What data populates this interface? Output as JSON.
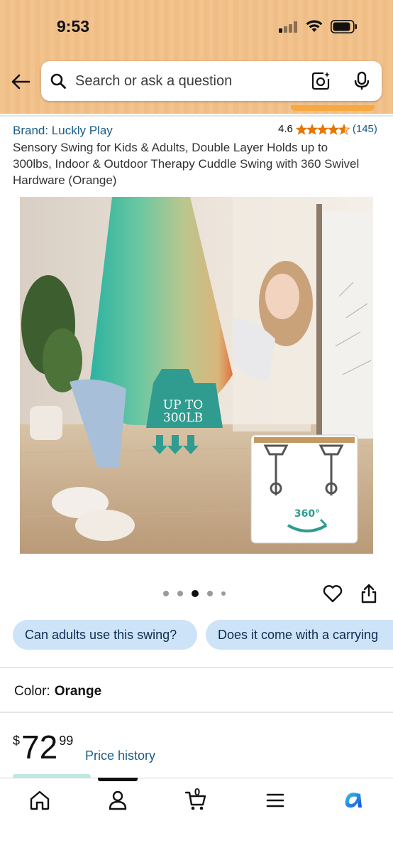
{
  "status_bar": {
    "time": "9:53"
  },
  "search": {
    "placeholder": "Search or ask a question"
  },
  "product": {
    "brand": "Brand: Luckly Play",
    "rating_value": "4.6",
    "rating_stars": 4.6,
    "rating_count": "(145)",
    "title": "Sensory Swing for Kids & Adults, Double Layer Holds up to 300lbs, Indoor & Outdoor Therapy Cuddle Swing with 360 Swivel Hardware (Orange)",
    "image_badge": {
      "line1": "UP TO",
      "line2": "300LB"
    },
    "image_hardware_label": "360°"
  },
  "gallery": {
    "dot_count": 5,
    "active_index": 2
  },
  "questions": [
    "Can adults use this swing?",
    "Does it come with a carrying"
  ],
  "color": {
    "label": "Color:",
    "value": "Orange"
  },
  "price": {
    "currency": "$",
    "whole": "72",
    "fraction": "99",
    "history_link": "Price history"
  },
  "nav": {
    "cart_count": "0",
    "items": [
      "home-icon",
      "account-icon",
      "cart-icon",
      "menu-icon",
      "assistant-icon"
    ]
  },
  "colors": {
    "header": "#f2c38d",
    "link": "#1a5c8a",
    "chip": "#cde3f7",
    "star": "#e77600"
  }
}
